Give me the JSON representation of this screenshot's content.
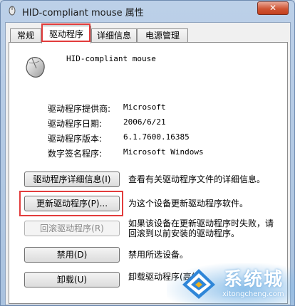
{
  "window": {
    "title": "HID-compliant mouse 属性",
    "close_label": "✕"
  },
  "tabs": [
    {
      "label": "常规"
    },
    {
      "label": "驱动程序"
    },
    {
      "label": "详细信息"
    },
    {
      "label": "电源管理"
    }
  ],
  "device": {
    "name": "HID-compliant mouse"
  },
  "driver_info": [
    {
      "label": "驱动程序提供商:",
      "value": "Microsoft"
    },
    {
      "label": "驱动程序日期:",
      "value": "2006/6/21"
    },
    {
      "label": "驱动程序版本:",
      "value": "6.1.7600.16385"
    },
    {
      "label": "数字签名程序:",
      "value": "Microsoft Windows"
    }
  ],
  "actions": [
    {
      "button": "驱动程序详细信息(I)",
      "description": "查看有关驱动程序文件的详细信息。"
    },
    {
      "button": "更新驱动程序(P)...",
      "description": "为这个设备更新驱动程序软件。"
    },
    {
      "button": "回滚驱动程序(R)",
      "description": "如果该设备在更新驱动程序时失败，请回滚到以前安装的驱动程序。"
    },
    {
      "button": "禁用(D)",
      "description": "禁用所选设备。"
    },
    {
      "button": "卸载(U)",
      "description": "卸载驱动程序(高级)。"
    }
  ],
  "watermark": {
    "name": "系统城",
    "url": "xitongcheng.com"
  },
  "colors": {
    "highlight": "#e23c3c",
    "window_frame": "#a9c2df"
  }
}
